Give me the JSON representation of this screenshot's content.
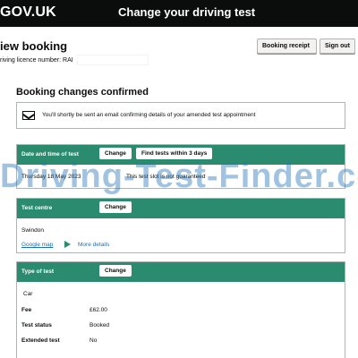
{
  "header": {
    "logo": "GOV.UK",
    "service_name": "Change your driving test"
  },
  "page": {
    "title": "iew booking",
    "licence_label": "riving licence number: RAI"
  },
  "actions": {
    "booking_receipt": "Booking receipt",
    "sign_out": "Sign out"
  },
  "confirmation": {
    "heading": "Booking changes confirmed",
    "message": "You'll shortly be sent an email confirming details of your amended test appointment",
    "icon": "envelope-icon"
  },
  "date_card": {
    "label": "Date and time of test",
    "change": "Change",
    "find": "Find tests within 3 days",
    "date_text": "Thursday 18 May 2023",
    "slot_text": "This test slot is not guaranteed"
  },
  "centre_card": {
    "label": "Test centre",
    "change": "Change",
    "centre": "Swindon",
    "map_link": "Google map",
    "more_details": "More details"
  },
  "type_card": {
    "label": "Type of test",
    "change": "Change",
    "type": "Car",
    "rows": [
      {
        "key": "Fee",
        "value": "£62.00"
      },
      {
        "key": "Test status",
        "value": "Booked"
      },
      {
        "key": "Extended test",
        "value": "No"
      }
    ]
  },
  "watermark": "Driving-Test-Finder.co",
  "colors": {
    "header": "#0b0c0c",
    "card_head": "#2b8b6f",
    "link": "#1d70b8",
    "watermark": "#1d70b8"
  }
}
